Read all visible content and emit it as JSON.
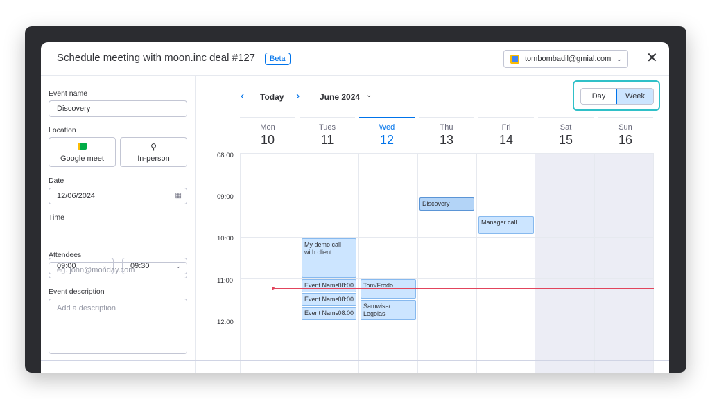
{
  "header": {
    "title": "Schedule meeting with moon.inc deal #127",
    "badge": "Beta",
    "account_email": "tombombadil@gmial.com",
    "account_icon": "google-calendar-icon",
    "close_glyph": "✕"
  },
  "form": {
    "event_name_label": "Event name",
    "event_name_value": "Discovery",
    "location_label": "Location",
    "location_google": "Google meet",
    "location_inperson": "In-person",
    "date_label": "Date",
    "date_value": "12/06/2024",
    "time_label": "Time",
    "time_start": "09:00",
    "time_end": "09:30",
    "attendees_label": "Attendees",
    "attendees_placeholder": "eg. john@monday.com",
    "description_label": "Event description",
    "description_placeholder": "Add a description"
  },
  "calendar": {
    "today_label": "Today",
    "month_label": "June 2024",
    "view_day": "Day",
    "view_week": "Week",
    "active_view": "Week",
    "days": [
      {
        "name": "Mon",
        "date": "10"
      },
      {
        "name": "Tues",
        "date": "11"
      },
      {
        "name": "Wed",
        "date": "12"
      },
      {
        "name": "Thu",
        "date": "13"
      },
      {
        "name": "Fri",
        "date": "14"
      },
      {
        "name": "Sat",
        "date": "15"
      },
      {
        "name": "Sun",
        "date": "16"
      }
    ],
    "current_day": "Wed",
    "hours": [
      "08:00",
      "09:00",
      "10:00",
      "11:00",
      "12:00"
    ],
    "events": [
      {
        "title": "Discovery",
        "day": "Thu"
      },
      {
        "title": "Manager call",
        "day": "Fri"
      },
      {
        "title": "My demo call with client",
        "day": "Tues"
      },
      {
        "title": "Event Name",
        "time": "08:00",
        "day": "Tues"
      },
      {
        "title": "Event Name",
        "time": "08:00",
        "day": "Tues"
      },
      {
        "title": "Event Name",
        "time": "08:00",
        "day": "Tues"
      },
      {
        "title": "Tom/Frodo",
        "day": "Wed"
      },
      {
        "title": "Samwise/ Legolas",
        "day": "Wed"
      }
    ],
    "colors": {
      "accent": "#0073ea",
      "event_bg": "#cce5ff",
      "now_line": "#e2445c",
      "highlight": "#30c0c8"
    }
  }
}
